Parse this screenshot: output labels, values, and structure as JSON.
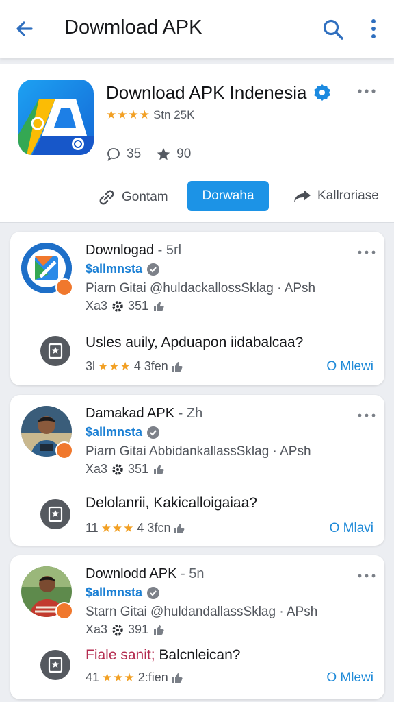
{
  "appbar": {
    "title": "Dowmload APK"
  },
  "app": {
    "name": "Download APK Indenesia",
    "stars": "★★★★",
    "rating_text": "Stn 25K",
    "comments": "35",
    "favorites": "90",
    "actions": {
      "left": "Gontam",
      "primary": "Dorwaha",
      "right": "Kallroriase"
    },
    "colors": {
      "primary": "#1c93e6",
      "star": "#f2a024"
    }
  },
  "posts": [
    {
      "title": "Downlogad",
      "meta": " - 5rl",
      "handle": "$allmnsta",
      "subline": "Piarn Gitai @huldackallossSklag · APsh",
      "counts_prefix": "Xa3",
      "counts_value": "351",
      "question": "Usles auily, Apduapon iidabalcaa?",
      "question_accent": "",
      "q_count": "3l",
      "q_stars": "★★★",
      "q_extra": "4 3fen",
      "view": "O Mlewi",
      "avatar_icon": "app-logo"
    },
    {
      "title": "Damakad APK",
      "meta": " - Zh",
      "handle": "$allmnsta",
      "subline": "Piarn Gitai AbbidankallassSklag · APsh",
      "counts_prefix": "Xa3",
      "counts_value": "351",
      "question": "Delolanrii, Kakicalloigaiaa?",
      "question_accent": "",
      "q_count": "11",
      "q_stars": "★★★",
      "q_extra": "4 3fcn",
      "view": "O Mlavi",
      "avatar_icon": "person-photo"
    },
    {
      "title": "Downlodd APK",
      "meta": " - 5n",
      "handle": "$allmnsta",
      "subline": "Starn Gitai @huldandallassSklag · APsh",
      "counts_prefix": "Xa3",
      "counts_value": "391",
      "question": " Balcnleican?",
      "question_accent": "Fiale sanit;",
      "q_count": "41",
      "q_stars": "★★★",
      "q_extra": "2:fien",
      "view": "O Mlewi",
      "avatar_icon": "person-photo"
    }
  ]
}
